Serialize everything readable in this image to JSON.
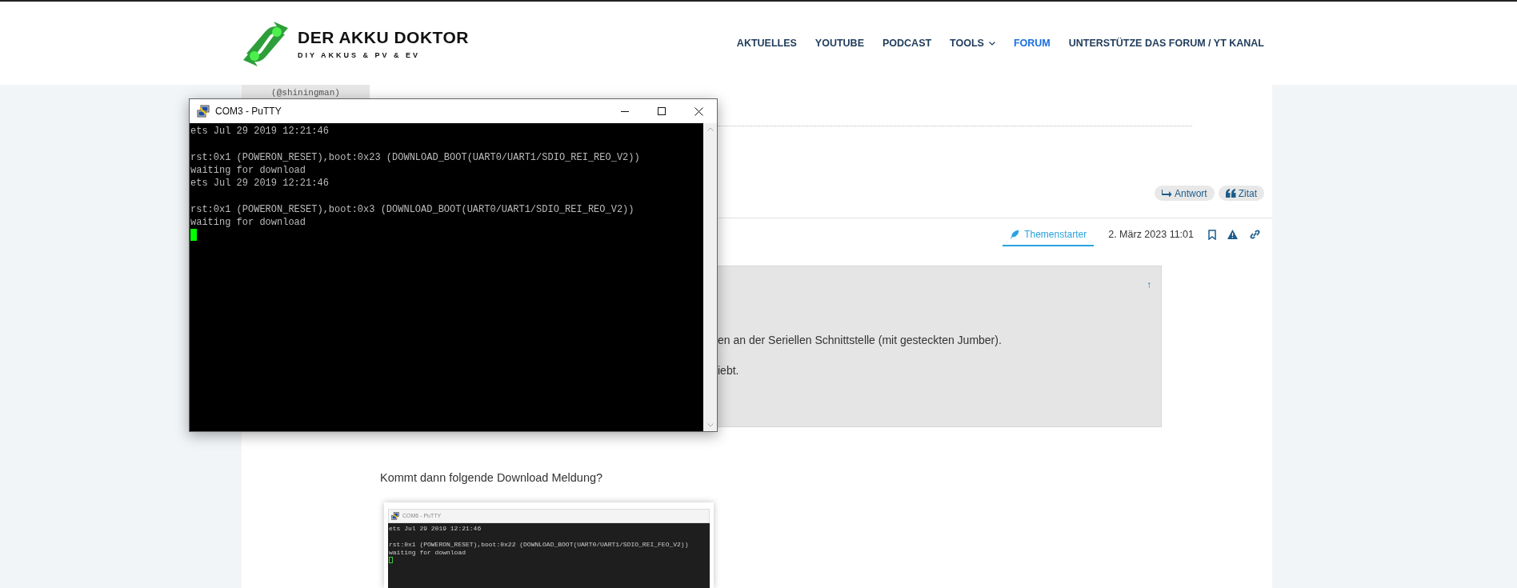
{
  "header": {
    "logo": {
      "title": "DER AKKU DOKTOR",
      "subtitle": "DIY AKKUS & PV & EV"
    },
    "nav": [
      {
        "label": "AKTUELLES",
        "selected": false,
        "dropdown": false
      },
      {
        "label": "YOUTUBE",
        "selected": false,
        "dropdown": false
      },
      {
        "label": "PODCAST",
        "selected": false,
        "dropdown": false
      },
      {
        "label": "TOOLS",
        "selected": false,
        "dropdown": true
      },
      {
        "label": "FORUM",
        "selected": true,
        "dropdown": false
      },
      {
        "label": "UNTERSTÜTZE DAS FORUM / YT KANAL",
        "selected": false,
        "dropdown": false
      }
    ]
  },
  "previous_post": {
    "user_handle": "(@shiningman)",
    "actions": [
      {
        "kind": "reply",
        "label": "Antwort"
      },
      {
        "kind": "quote",
        "label": "Zitat"
      }
    ]
  },
  "post": {
    "badge": "Themenstarter",
    "date": "2. März 2023 11:01",
    "quote": {
      "arrow": "↑",
      "lines": [
        "en an der Seriellen Schnittstelle (mit gesteckten Jumber).",
        "iebt."
      ]
    },
    "text": "Kommt dann folgende Download Meldung?",
    "image": {
      "title": "COM6 - PuTTY",
      "blocks": [
        [
          "ets Jul 29 2019 12:21:46"
        ],
        [
          "rst:0x1 (POWERON_RESET),boot:0x22 (DOWNLOAD_BOOT(UART0/UART1/SDIO_REI_FEO_V2))",
          "waiting for download"
        ]
      ]
    }
  },
  "putty": {
    "title": "COM3 - PuTTY",
    "blocks": [
      [
        "ets Jul 29 2019 12:21:46"
      ],
      [
        "rst:0x1 (POWERON_RESET),boot:0x23 (DOWNLOAD_BOOT(UART0/UART1/SDIO_REI_REO_V2))",
        "waiting for download",
        "ets Jul 29 2019 12:21:46"
      ],
      [
        "rst:0x1 (POWERON_RESET),boot:0x3 (DOWNLOAD_BOOT(UART0/UART1/SDIO_REI_REO_V2))",
        "waiting for download"
      ]
    ]
  }
}
